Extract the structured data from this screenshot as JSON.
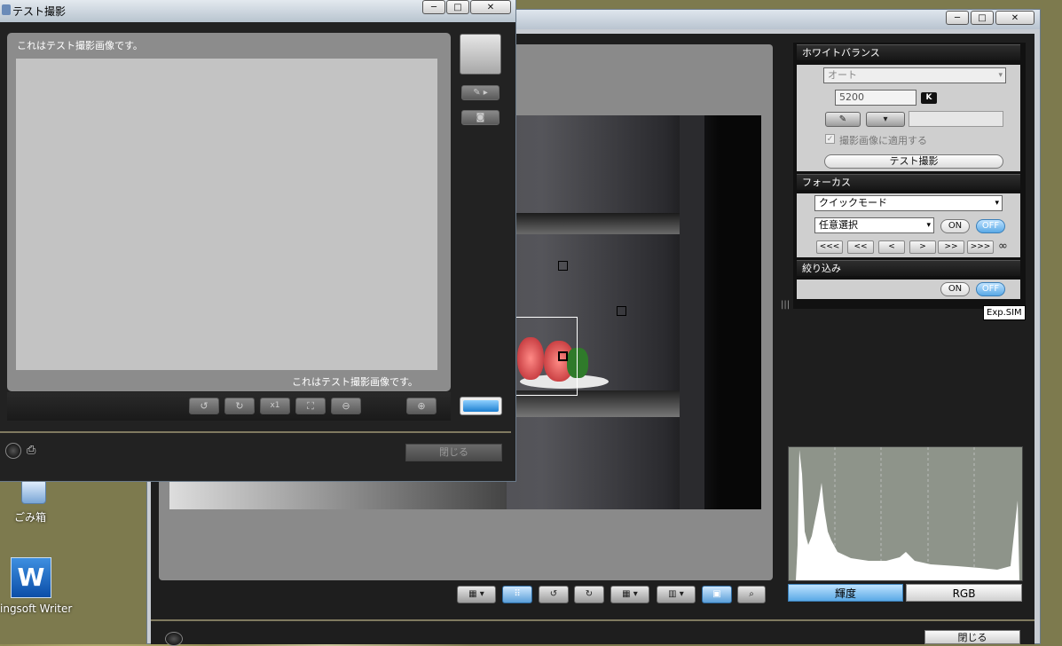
{
  "desktop": {
    "icons": [
      {
        "label": "ごみ箱",
        "icon": "recycle-bin-icon"
      },
      {
        "label": "ingsoft Writer",
        "icon": "writer-app-icon"
      }
    ]
  },
  "main_window": {
    "controls": {
      "minimize": "─",
      "maximize": "□",
      "close": "✕"
    },
    "white_balance": {
      "header": "ホワイトバランス",
      "mode": "オート",
      "kelvin_value": "5200",
      "kelvin_unit": "K",
      "apply_checkbox_label": "撮影画像に適用する",
      "test_shot_button": "テスト撮影"
    },
    "focus": {
      "header": "フォーカス",
      "mode": "クイックモード",
      "point_select": "任意選択",
      "on": "ON",
      "off": "OFF",
      "nav": [
        "<<<",
        "<<",
        "<",
        ">",
        ">>",
        ">>>"
      ],
      "infinity": "∞"
    },
    "aperture": {
      "header": "絞り込み",
      "on": "ON",
      "off": "OFF"
    },
    "exp_sim": "Exp.SIM",
    "histogram": {
      "tabs": [
        "輝度",
        "RGB"
      ],
      "selected": "輝度"
    },
    "close_button": "閉じる",
    "colors": {
      "accent": "#5aa9e6",
      "panel": "#cfcfcf",
      "frame": "#1e1e1e"
    }
  },
  "dialog": {
    "title": "テスト撮影",
    "controls": {
      "minimize": "─",
      "maximize": "□",
      "close": "✕"
    },
    "caption_top": "これはテスト撮影画像です。",
    "caption_bottom": "これはテスト撮影画像です。",
    "tools": {
      "rotate_left": "↺",
      "rotate_right": "↻",
      "x1": "x1",
      "fit": "⛶",
      "zoom_out": "🔍",
      "zoom_in": "🔍"
    },
    "close_button": "閉じる"
  }
}
